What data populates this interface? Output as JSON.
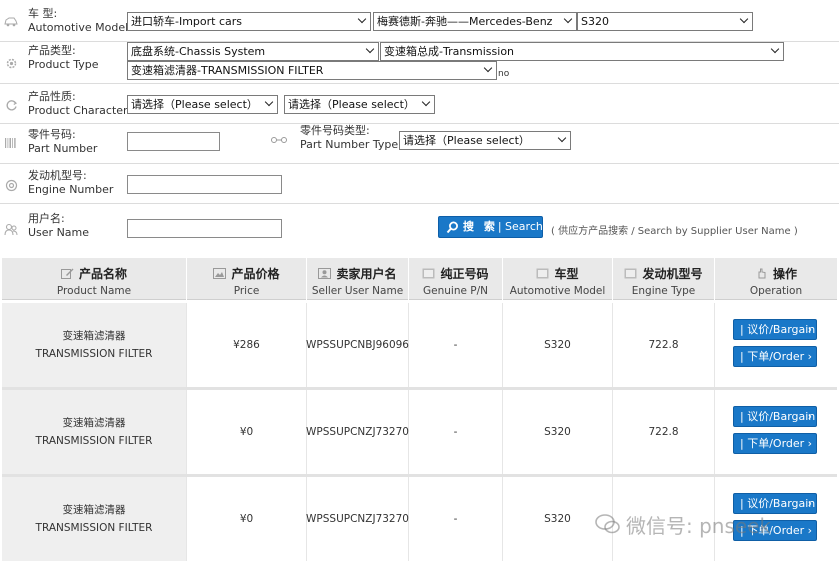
{
  "form": {
    "automotive_model": {
      "label_cn": "车  型:",
      "label_en": "Automotive Model",
      "select_1": "进口轿车-Import cars",
      "select_2": "梅赛德斯-奔驰——Mercedes-Benz",
      "select_3": "S320"
    },
    "product_type": {
      "label_cn": "产品类型:",
      "label_en": "Product Type",
      "select_1": "底盘系统-Chassis System",
      "select_2": "变速箱总成-Transmission",
      "select_3": "变速箱滤清器-TRANSMISSION FILTER",
      "trailing": "no"
    },
    "product_character": {
      "label_cn": "产品性质:",
      "label_en": "Product Character",
      "select_1": "请选择（Please select）",
      "select_2": "请选择（Please select）"
    },
    "part_number": {
      "label_cn": "零件号码:",
      "label_en": "Part Number",
      "value": ""
    },
    "part_number_type": {
      "label_cn": "零件号码类型:",
      "label_en": "Part Number Type",
      "select": "请选择（Please select）"
    },
    "engine_number": {
      "label_cn": "发动机型号:",
      "label_en": "Engine Number",
      "value": ""
    },
    "user_name": {
      "label_cn": "用户名:",
      "label_en": "User Name",
      "value": ""
    },
    "search_button": {
      "cn": "搜 索",
      "en": "| Search"
    },
    "search_hint": "( 供应方产品搜索 / Search by Supplier User Name )"
  },
  "table": {
    "columns": [
      {
        "cn": "产品名称",
        "en": "Product Name",
        "icon": "edit-icon"
      },
      {
        "cn": "产品价格",
        "en": "Price",
        "icon": "image-icon"
      },
      {
        "cn": "卖家用户名",
        "en": "Seller User Name",
        "icon": "user-card-icon"
      },
      {
        "cn": "纯正号码",
        "en": "Genuine P/N",
        "icon": "barcode-icon"
      },
      {
        "cn": "车型",
        "en": "Automotive Model",
        "icon": "car-icon"
      },
      {
        "cn": "发动机型号",
        "en": "Engine Type",
        "icon": "engine-icon"
      },
      {
        "cn": "操作",
        "en": "Operation",
        "icon": "hand-icon"
      }
    ],
    "rows": [
      {
        "name_cn": "变速箱滤清器",
        "name_en": "TRANSMISSION FILTER",
        "price": "¥286",
        "seller": "WPSSUPCNBJ96096",
        "genuine_pn": "-",
        "model": "S320",
        "engine": "722.8",
        "bargain": "| 议价/Bargain",
        "order": "| 下单/Order"
      },
      {
        "name_cn": "变速箱滤清器",
        "name_en": "TRANSMISSION FILTER",
        "price": "¥0",
        "seller": "WPSSUPCNZJ73270",
        "genuine_pn": "-",
        "model": "S320",
        "engine": "722.8",
        "bargain": "| 议价/Bargain",
        "order": "| 下单/Order"
      },
      {
        "name_cn": "变速箱滤清器",
        "name_en": "TRANSMISSION FILTER",
        "price": "¥0",
        "seller": "WPSSUPCNZJ73270",
        "genuine_pn": "-",
        "model": "S320",
        "engine": "",
        "bargain": "| 议价/Bargain",
        "order": "| 下单/Order"
      }
    ]
  },
  "watermark": "微信号: pnseek",
  "colors": {
    "accent": "#1a78c8",
    "header_bg": "#e9e9e9",
    "name_cell_bg": "#efefef"
  }
}
